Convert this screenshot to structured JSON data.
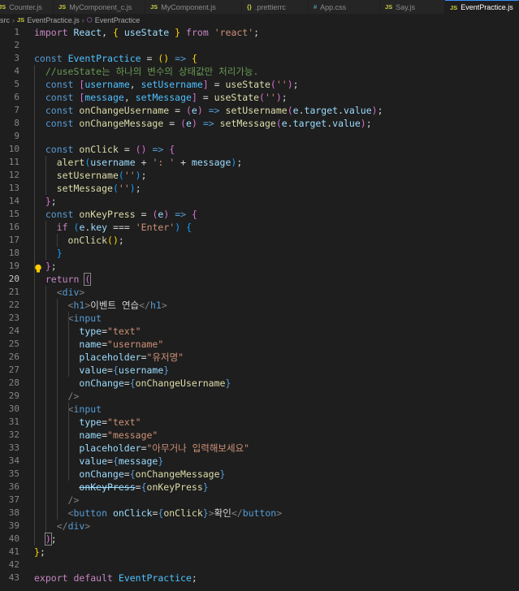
{
  "tabs": [
    {
      "icon": "JS",
      "name": "Counter.js"
    },
    {
      "icon": "JS",
      "name": "MyComponent_c.js"
    },
    {
      "icon": "JS",
      "name": "MyComponent.js"
    },
    {
      "icon": "{}",
      "name": ".prettierrc"
    },
    {
      "icon": "#",
      "name": "App.css"
    },
    {
      "icon": "JS",
      "name": "Say.js"
    },
    {
      "icon": "JS",
      "name": "EventPractice.js"
    }
  ],
  "breadcrumb": {
    "folder": "src",
    "file_icon": "JS",
    "file": "EventPractice.js",
    "symbol": "EventPractice"
  },
  "lines": [
    [
      [
        "t-kc",
        "import"
      ],
      [
        "t-pl",
        " "
      ],
      [
        "t-var",
        "React"
      ],
      [
        "t-pl",
        ", "
      ],
      [
        "t-b1",
        "{"
      ],
      [
        "t-pl",
        " "
      ],
      [
        "t-var",
        "useState"
      ],
      [
        "t-pl",
        " "
      ],
      [
        "t-b1",
        "}"
      ],
      [
        "t-pl",
        " "
      ],
      [
        "t-kc",
        "from"
      ],
      [
        "t-pl",
        " "
      ],
      [
        "t-str",
        "'react'"
      ],
      [
        "t-pl",
        ";"
      ]
    ],
    [],
    [
      [
        "t-kw",
        "const"
      ],
      [
        "t-pl",
        " "
      ],
      [
        "t-const",
        "EventPractice"
      ],
      [
        "t-pl",
        " = "
      ],
      [
        "t-b1",
        "("
      ],
      [
        "t-b1",
        ")"
      ],
      [
        "t-pl",
        " "
      ],
      [
        "t-kw",
        "=>"
      ],
      [
        "t-pl",
        " "
      ],
      [
        "t-b1",
        "{"
      ]
    ],
    [
      [
        "t-pl",
        "  "
      ],
      [
        "t-cm",
        "//useState는 하나의 변수의 상태값만 처리가능."
      ]
    ],
    [
      [
        "t-pl",
        "  "
      ],
      [
        "t-kw",
        "const"
      ],
      [
        "t-pl",
        " "
      ],
      [
        "t-b2",
        "["
      ],
      [
        "t-const",
        "username"
      ],
      [
        "t-pl",
        ", "
      ],
      [
        "t-const",
        "setUsername"
      ],
      [
        "t-b2",
        "]"
      ],
      [
        "t-pl",
        " = "
      ],
      [
        "t-fn",
        "useState"
      ],
      [
        "t-b2",
        "("
      ],
      [
        "t-str",
        "''"
      ],
      [
        "t-b2",
        ")"
      ],
      [
        "t-pl",
        ";"
      ]
    ],
    [
      [
        "t-pl",
        "  "
      ],
      [
        "t-kw",
        "const"
      ],
      [
        "t-pl",
        " "
      ],
      [
        "t-b2",
        "["
      ],
      [
        "t-const",
        "message"
      ],
      [
        "t-pl",
        ", "
      ],
      [
        "t-const",
        "setMessage"
      ],
      [
        "t-b2",
        "]"
      ],
      [
        "t-pl",
        " = "
      ],
      [
        "t-fn",
        "useState"
      ],
      [
        "t-b2",
        "("
      ],
      [
        "t-str",
        "''"
      ],
      [
        "t-b2",
        ")"
      ],
      [
        "t-pl",
        ";"
      ]
    ],
    [
      [
        "t-pl",
        "  "
      ],
      [
        "t-kw",
        "const"
      ],
      [
        "t-pl",
        " "
      ],
      [
        "t-fn",
        "onChangeUsername"
      ],
      [
        "t-pl",
        " = "
      ],
      [
        "t-b2",
        "("
      ],
      [
        "t-var",
        "e"
      ],
      [
        "t-b2",
        ")"
      ],
      [
        "t-pl",
        " "
      ],
      [
        "t-kw",
        "=>"
      ],
      [
        "t-pl",
        " "
      ],
      [
        "t-fn",
        "setUsername"
      ],
      [
        "t-b2",
        "("
      ],
      [
        "t-var",
        "e"
      ],
      [
        "t-pl",
        "."
      ],
      [
        "t-var",
        "target"
      ],
      [
        "t-pl",
        "."
      ],
      [
        "t-var",
        "value"
      ],
      [
        "t-b2",
        ")"
      ],
      [
        "t-pl",
        ";"
      ]
    ],
    [
      [
        "t-pl",
        "  "
      ],
      [
        "t-kw",
        "const"
      ],
      [
        "t-pl",
        " "
      ],
      [
        "t-fn",
        "onChangeMessage"
      ],
      [
        "t-pl",
        " = "
      ],
      [
        "t-b2",
        "("
      ],
      [
        "t-var",
        "e"
      ],
      [
        "t-b2",
        ")"
      ],
      [
        "t-pl",
        " "
      ],
      [
        "t-kw",
        "=>"
      ],
      [
        "t-pl",
        " "
      ],
      [
        "t-fn",
        "setMessage"
      ],
      [
        "t-b2",
        "("
      ],
      [
        "t-var",
        "e"
      ],
      [
        "t-pl",
        "."
      ],
      [
        "t-var",
        "target"
      ],
      [
        "t-pl",
        "."
      ],
      [
        "t-var",
        "value"
      ],
      [
        "t-b2",
        ")"
      ],
      [
        "t-pl",
        ";"
      ]
    ],
    [],
    [
      [
        "t-pl",
        "  "
      ],
      [
        "t-kw",
        "const"
      ],
      [
        "t-pl",
        " "
      ],
      [
        "t-fn",
        "onClick"
      ],
      [
        "t-pl",
        " = "
      ],
      [
        "t-b2",
        "("
      ],
      [
        "t-b2",
        ")"
      ],
      [
        "t-pl",
        " "
      ],
      [
        "t-kw",
        "=>"
      ],
      [
        "t-pl",
        " "
      ],
      [
        "t-b2",
        "{"
      ]
    ],
    [
      [
        "t-pl",
        "    "
      ],
      [
        "t-fn",
        "alert"
      ],
      [
        "t-b3",
        "("
      ],
      [
        "t-var",
        "username"
      ],
      [
        "t-pl",
        " + "
      ],
      [
        "t-str",
        "': '"
      ],
      [
        "t-pl",
        " + "
      ],
      [
        "t-var",
        "message"
      ],
      [
        "t-b3",
        ")"
      ],
      [
        "t-pl",
        ";"
      ]
    ],
    [
      [
        "t-pl",
        "    "
      ],
      [
        "t-fn",
        "setUsername"
      ],
      [
        "t-b3",
        "("
      ],
      [
        "t-str",
        "''"
      ],
      [
        "t-b3",
        ")"
      ],
      [
        "t-pl",
        ";"
      ]
    ],
    [
      [
        "t-pl",
        "    "
      ],
      [
        "t-fn",
        "setMessage"
      ],
      [
        "t-b3",
        "("
      ],
      [
        "t-str",
        "''"
      ],
      [
        "t-b3",
        ")"
      ],
      [
        "t-pl",
        ";"
      ]
    ],
    [
      [
        "t-pl",
        "  "
      ],
      [
        "t-b2",
        "}"
      ],
      [
        "t-pl",
        ";"
      ]
    ],
    [
      [
        "t-pl",
        "  "
      ],
      [
        "t-kw",
        "const"
      ],
      [
        "t-pl",
        " "
      ],
      [
        "t-fn",
        "onKeyPress"
      ],
      [
        "t-pl",
        " = "
      ],
      [
        "t-b2",
        "("
      ],
      [
        "t-var",
        "e"
      ],
      [
        "t-b2",
        ")"
      ],
      [
        "t-pl",
        " "
      ],
      [
        "t-kw",
        "=>"
      ],
      [
        "t-pl",
        " "
      ],
      [
        "t-b2",
        "{"
      ]
    ],
    [
      [
        "t-pl",
        "    "
      ],
      [
        "t-kc",
        "if"
      ],
      [
        "t-pl",
        " "
      ],
      [
        "t-b3",
        "("
      ],
      [
        "t-var",
        "e"
      ],
      [
        "t-pl",
        "."
      ],
      [
        "t-var",
        "key"
      ],
      [
        "t-pl",
        " === "
      ],
      [
        "t-str",
        "'Enter'"
      ],
      [
        "t-b3",
        ")"
      ],
      [
        "t-pl",
        " "
      ],
      [
        "t-b3",
        "{"
      ]
    ],
    [
      [
        "t-pl",
        "      "
      ],
      [
        "t-fn",
        "onClick"
      ],
      [
        "t-b1",
        "("
      ],
      [
        "t-b1",
        ")"
      ],
      [
        "t-pl",
        ";"
      ]
    ],
    [
      [
        "t-pl",
        "    "
      ],
      [
        "t-b3",
        "}"
      ]
    ],
    [
      [
        "t-pl",
        "  "
      ],
      [
        "t-b2",
        "}"
      ],
      [
        "t-pl",
        ";"
      ]
    ],
    [
      [
        "t-pl",
        "  "
      ],
      [
        "t-kc",
        "return"
      ],
      [
        "t-pl",
        " "
      ],
      [
        "t-b2 bbox",
        "("
      ]
    ],
    [
      [
        "t-pl",
        "    "
      ],
      [
        "t-tgp",
        "<"
      ],
      [
        "t-tag",
        "div"
      ],
      [
        "t-tgp",
        ">"
      ]
    ],
    [
      [
        "t-pl",
        "      "
      ],
      [
        "t-tgp",
        "<"
      ],
      [
        "t-tag",
        "h1"
      ],
      [
        "t-tgp",
        ">"
      ],
      [
        "t-pl",
        "이벤트 연습"
      ],
      [
        "t-tgp",
        "</"
      ],
      [
        "t-tag",
        "h1"
      ],
      [
        "t-tgp",
        ">"
      ]
    ],
    [
      [
        "t-pl",
        "      "
      ],
      [
        "t-tgp",
        "<"
      ],
      [
        "t-tag",
        "input"
      ]
    ],
    [
      [
        "t-pl",
        "        "
      ],
      [
        "t-attr",
        "type"
      ],
      [
        "t-pl",
        "="
      ],
      [
        "t-str",
        "\"text\""
      ]
    ],
    [
      [
        "t-pl",
        "        "
      ],
      [
        "t-attr",
        "name"
      ],
      [
        "t-pl",
        "="
      ],
      [
        "t-str",
        "\"username\""
      ]
    ],
    [
      [
        "t-pl",
        "        "
      ],
      [
        "t-attr",
        "placeholder"
      ],
      [
        "t-pl",
        "="
      ],
      [
        "t-str",
        "\"유저명\""
      ]
    ],
    [
      [
        "t-pl",
        "        "
      ],
      [
        "t-attr",
        "value"
      ],
      [
        "t-pl",
        "="
      ],
      [
        "t-kw",
        "{"
      ],
      [
        "t-var",
        "username"
      ],
      [
        "t-kw",
        "}"
      ]
    ],
    [
      [
        "t-pl",
        "        "
      ],
      [
        "t-attr",
        "onChange"
      ],
      [
        "t-pl",
        "="
      ],
      [
        "t-kw",
        "{"
      ],
      [
        "t-fn",
        "onChangeUsername"
      ],
      [
        "t-kw",
        "}"
      ]
    ],
    [
      [
        "t-pl",
        "      "
      ],
      [
        "t-tgp",
        "/>"
      ]
    ],
    [
      [
        "t-pl",
        "      "
      ],
      [
        "t-tgp",
        "<"
      ],
      [
        "t-tag",
        "input"
      ]
    ],
    [
      [
        "t-pl",
        "        "
      ],
      [
        "t-attr",
        "type"
      ],
      [
        "t-pl",
        "="
      ],
      [
        "t-str",
        "\"text\""
      ]
    ],
    [
      [
        "t-pl",
        "        "
      ],
      [
        "t-attr",
        "name"
      ],
      [
        "t-pl",
        "="
      ],
      [
        "t-str",
        "\"message\""
      ]
    ],
    [
      [
        "t-pl",
        "        "
      ],
      [
        "t-attr",
        "placeholder"
      ],
      [
        "t-pl",
        "="
      ],
      [
        "t-str",
        "\"아무거나 입력해보세요\""
      ]
    ],
    [
      [
        "t-pl",
        "        "
      ],
      [
        "t-attr",
        "value"
      ],
      [
        "t-pl",
        "="
      ],
      [
        "t-kw",
        "{"
      ],
      [
        "t-var",
        "message"
      ],
      [
        "t-kw",
        "}"
      ]
    ],
    [
      [
        "t-pl",
        "        "
      ],
      [
        "t-attr",
        "onChange"
      ],
      [
        "t-pl",
        "="
      ],
      [
        "t-kw",
        "{"
      ],
      [
        "t-fn",
        "onChangeMessage"
      ],
      [
        "t-kw",
        "}"
      ]
    ],
    [
      [
        "t-pl",
        "        "
      ],
      [
        "t-strike",
        "onKeyPress"
      ],
      [
        "t-pl",
        "="
      ],
      [
        "t-kw",
        "{"
      ],
      [
        "t-fn",
        "onKeyPress"
      ],
      [
        "t-kw",
        "}"
      ]
    ],
    [
      [
        "t-pl",
        "      "
      ],
      [
        "t-tgp",
        "/>"
      ]
    ],
    [
      [
        "t-pl",
        "      "
      ],
      [
        "t-tgp",
        "<"
      ],
      [
        "t-tag",
        "button"
      ],
      [
        "t-pl",
        " "
      ],
      [
        "t-attr",
        "onClick"
      ],
      [
        "t-pl",
        "="
      ],
      [
        "t-kw",
        "{"
      ],
      [
        "t-fn",
        "onClick"
      ],
      [
        "t-kw",
        "}"
      ],
      [
        "t-tgp",
        ">"
      ],
      [
        "t-pl",
        "확인"
      ],
      [
        "t-tgp",
        "</"
      ],
      [
        "t-tag",
        "button"
      ],
      [
        "t-tgp",
        ">"
      ]
    ],
    [
      [
        "t-pl",
        "    "
      ],
      [
        "t-tgp",
        "</"
      ],
      [
        "t-tag",
        "div"
      ],
      [
        "t-tgp",
        ">"
      ]
    ],
    [
      [
        "t-pl",
        "  "
      ],
      [
        "t-b2 bbox",
        ")"
      ],
      [
        "t-pl",
        ";"
      ]
    ],
    [
      [
        "t-b1",
        "}"
      ],
      [
        "t-pl",
        ";"
      ]
    ],
    [],
    [
      [
        "t-kc",
        "export"
      ],
      [
        "t-pl",
        " "
      ],
      [
        "t-kc",
        "default"
      ],
      [
        "t-pl",
        " "
      ],
      [
        "t-const",
        "EventPractice"
      ],
      [
        "t-pl",
        ";"
      ]
    ]
  ],
  "current_line": 20,
  "lightbulb_line": 19
}
